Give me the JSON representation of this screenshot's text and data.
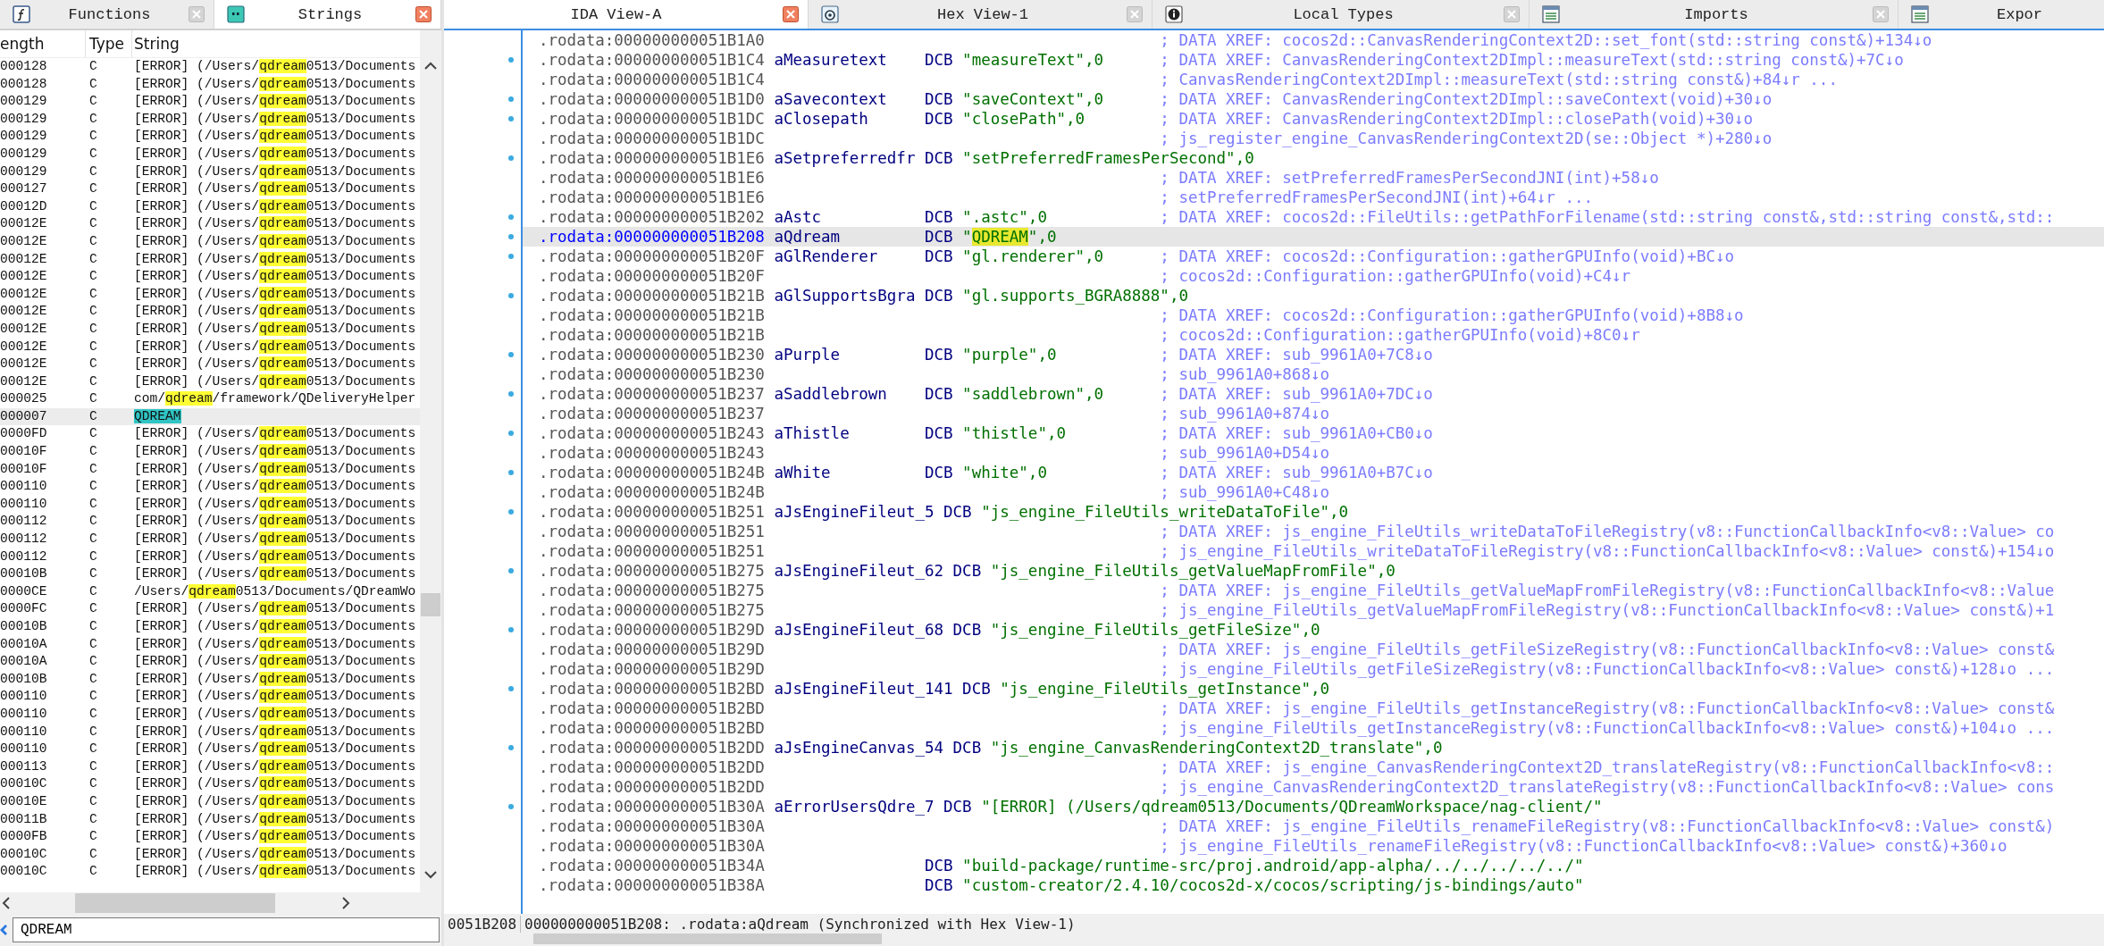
{
  "left_tabs": [
    {
      "label": "Functions",
      "selected": false,
      "kind": "functions"
    },
    {
      "label": "Strings",
      "selected": true,
      "kind": "strings"
    }
  ],
  "strings_table": {
    "columns": [
      "ength",
      "Type",
      "String"
    ],
    "rows": [
      {
        "length": "000128",
        "type": "C",
        "before": "[ERROR] (/Users/",
        "match": "qdream",
        "after": "0513/Documents",
        "selected": false
      },
      {
        "length": "000128",
        "type": "C",
        "before": "[ERROR] (/Users/",
        "match": "qdream",
        "after": "0513/Documents",
        "selected": false
      },
      {
        "length": "000129",
        "type": "C",
        "before": "[ERROR] (/Users/",
        "match": "qdream",
        "after": "0513/Documents",
        "selected": false
      },
      {
        "length": "000129",
        "type": "C",
        "before": "[ERROR] (/Users/",
        "match": "qdream",
        "after": "0513/Documents",
        "selected": false
      },
      {
        "length": "000129",
        "type": "C",
        "before": "[ERROR] (/Users/",
        "match": "qdream",
        "after": "0513/Documents",
        "selected": false
      },
      {
        "length": "000129",
        "type": "C",
        "before": "[ERROR] (/Users/",
        "match": "qdream",
        "after": "0513/Documents",
        "selected": false
      },
      {
        "length": "000129",
        "type": "C",
        "before": "[ERROR] (/Users/",
        "match": "qdream",
        "after": "0513/Documents",
        "selected": false
      },
      {
        "length": "000127",
        "type": "C",
        "before": "[ERROR] (/Users/",
        "match": "qdream",
        "after": "0513/Documents",
        "selected": false
      },
      {
        "length": "00012D",
        "type": "C",
        "before": "[ERROR] (/Users/",
        "match": "qdream",
        "after": "0513/Documents",
        "selected": false
      },
      {
        "length": "00012E",
        "type": "C",
        "before": "[ERROR] (/Users/",
        "match": "qdream",
        "after": "0513/Documents",
        "selected": false
      },
      {
        "length": "00012E",
        "type": "C",
        "before": "[ERROR] (/Users/",
        "match": "qdream",
        "after": "0513/Documents",
        "selected": false
      },
      {
        "length": "00012E",
        "type": "C",
        "before": "[ERROR] (/Users/",
        "match": "qdream",
        "after": "0513/Documents",
        "selected": false
      },
      {
        "length": "00012E",
        "type": "C",
        "before": "[ERROR] (/Users/",
        "match": "qdream",
        "after": "0513/Documents",
        "selected": false
      },
      {
        "length": "00012E",
        "type": "C",
        "before": "[ERROR] (/Users/",
        "match": "qdream",
        "after": "0513/Documents",
        "selected": false
      },
      {
        "length": "00012E",
        "type": "C",
        "before": "[ERROR] (/Users/",
        "match": "qdream",
        "after": "0513/Documents",
        "selected": false
      },
      {
        "length": "00012E",
        "type": "C",
        "before": "[ERROR] (/Users/",
        "match": "qdream",
        "after": "0513/Documents",
        "selected": false
      },
      {
        "length": "00012E",
        "type": "C",
        "before": "[ERROR] (/Users/",
        "match": "qdream",
        "after": "0513/Documents",
        "selected": false
      },
      {
        "length": "00012E",
        "type": "C",
        "before": "[ERROR] (/Users/",
        "match": "qdream",
        "after": "0513/Documents",
        "selected": false
      },
      {
        "length": "00012E",
        "type": "C",
        "before": "[ERROR] (/Users/",
        "match": "qdream",
        "after": "0513/Documents",
        "selected": false
      },
      {
        "length": "000025",
        "type": "C",
        "before": "com/",
        "match": "qdream",
        "after": "/framework/QDeliveryHelper",
        "selected": false
      },
      {
        "length": "000007",
        "type": "C",
        "match": "QDREAM",
        "selected": true
      },
      {
        "length": "0000FD",
        "type": "C",
        "before": "[ERROR] (/Users/",
        "match": "qdream",
        "after": "0513/Documents",
        "selected": false
      },
      {
        "length": "00010F",
        "type": "C",
        "before": "[ERROR] (/Users/",
        "match": "qdream",
        "after": "0513/Documents",
        "selected": false
      },
      {
        "length": "00010F",
        "type": "C",
        "before": "[ERROR] (/Users/",
        "match": "qdream",
        "after": "0513/Documents",
        "selected": false
      },
      {
        "length": "000110",
        "type": "C",
        "before": "[ERROR] (/Users/",
        "match": "qdream",
        "after": "0513/Documents",
        "selected": false
      },
      {
        "length": "000110",
        "type": "C",
        "before": "[ERROR] (/Users/",
        "match": "qdream",
        "after": "0513/Documents",
        "selected": false
      },
      {
        "length": "000112",
        "type": "C",
        "before": "[ERROR] (/Users/",
        "match": "qdream",
        "after": "0513/Documents",
        "selected": false
      },
      {
        "length": "000112",
        "type": "C",
        "before": "[ERROR] (/Users/",
        "match": "qdream",
        "after": "0513/Documents",
        "selected": false
      },
      {
        "length": "000112",
        "type": "C",
        "before": "[ERROR] (/Users/",
        "match": "qdream",
        "after": "0513/Documents",
        "selected": false
      },
      {
        "length": "00010B",
        "type": "C",
        "before": "[ERROR] (/Users/",
        "match": "qdream",
        "after": "0513/Documents",
        "selected": false
      },
      {
        "length": "0000CE",
        "type": "C",
        "before": "/Users/",
        "match": "qdream",
        "after": "0513/Documents/QDreamWo",
        "selected": false
      },
      {
        "length": "0000FC",
        "type": "C",
        "before": "[ERROR] (/Users/",
        "match": "qdream",
        "after": "0513/Documents",
        "selected": false
      },
      {
        "length": "00010B",
        "type": "C",
        "before": "[ERROR] (/Users/",
        "match": "qdream",
        "after": "0513/Documents",
        "selected": false
      },
      {
        "length": "00010A",
        "type": "C",
        "before": "[ERROR] (/Users/",
        "match": "qdream",
        "after": "0513/Documents",
        "selected": false
      },
      {
        "length": "00010A",
        "type": "C",
        "before": "[ERROR] (/Users/",
        "match": "qdream",
        "after": "0513/Documents",
        "selected": false
      },
      {
        "length": "00010B",
        "type": "C",
        "before": "[ERROR] (/Users/",
        "match": "qdream",
        "after": "0513/Documents",
        "selected": false
      },
      {
        "length": "000110",
        "type": "C",
        "before": "[ERROR] (/Users/",
        "match": "qdream",
        "after": "0513/Documents",
        "selected": false
      },
      {
        "length": "000110",
        "type": "C",
        "before": "[ERROR] (/Users/",
        "match": "qdream",
        "after": "0513/Documents",
        "selected": false
      },
      {
        "length": "000110",
        "type": "C",
        "before": "[ERROR] (/Users/",
        "match": "qdream",
        "after": "0513/Documents",
        "selected": false
      },
      {
        "length": "000110",
        "type": "C",
        "before": "[ERROR] (/Users/",
        "match": "qdream",
        "after": "0513/Documents",
        "selected": false
      },
      {
        "length": "000113",
        "type": "C",
        "before": "[ERROR] (/Users/",
        "match": "qdream",
        "after": "0513/Documents",
        "selected": false
      },
      {
        "length": "00010C",
        "type": "C",
        "before": "[ERROR] (/Users/",
        "match": "qdream",
        "after": "0513/Documents",
        "selected": false
      },
      {
        "length": "00010E",
        "type": "C",
        "before": "[ERROR] (/Users/",
        "match": "qdream",
        "after": "0513/Documents",
        "selected": false
      },
      {
        "length": "00011B",
        "type": "C",
        "before": "[ERROR] (/Users/",
        "match": "qdream",
        "after": "0513/Documents",
        "selected": false
      },
      {
        "length": "0000FB",
        "type": "C",
        "before": "[ERROR] (/Users/",
        "match": "qdream",
        "after": "0513/Documents",
        "selected": false
      },
      {
        "length": "00010C",
        "type": "C",
        "before": "[ERROR] (/Users/",
        "match": "qdream",
        "after": "0513/Documents",
        "selected": false
      },
      {
        "length": "00010C",
        "type": "C",
        "before": "[ERROR] (/Users/",
        "match": "qdream",
        "after": "0513/Documents",
        "selected": false
      }
    ]
  },
  "search": {
    "value": "QDREAM"
  },
  "tabs": [
    {
      "label": "IDA View-A",
      "selected": true,
      "kind": "ida"
    },
    {
      "label": "Hex View-1",
      "selected": false,
      "kind": "hex"
    },
    {
      "label": "Local Types",
      "selected": false,
      "kind": "types"
    },
    {
      "label": "Imports",
      "selected": false,
      "kind": "imports"
    },
    {
      "label": "Expor",
      "selected": false,
      "kind": "exports"
    }
  ],
  "listing": [
    {
      "address": ".rodata:000000000051B1A0",
      "marked": false,
      "selected": false,
      "comment": "; DATA XREF: cocos2d::CanvasRenderingContext2D::set_font(std::string const&)+134↓o"
    },
    {
      "address": ".rodata:000000000051B1C4",
      "marked": true,
      "selected": false,
      "label": "aMeasuretext",
      "directive": "DCB",
      "value": "\"measureText\",0",
      "comment": "; DATA XREF: CanvasRenderingContext2DImpl::measureText(std::string const&)+7C↓o"
    },
    {
      "address": ".rodata:000000000051B1C4",
      "marked": false,
      "selected": false,
      "comment": "; CanvasRenderingContext2DImpl::measureText(std::string const&)+84↓r ..."
    },
    {
      "address": ".rodata:000000000051B1D0",
      "marked": true,
      "selected": false,
      "label": "aSavecontext",
      "directive": "DCB",
      "value": "\"saveContext\",0",
      "comment": "; DATA XREF: CanvasRenderingContext2DImpl::saveContext(void)+30↓o"
    },
    {
      "address": ".rodata:000000000051B1DC",
      "marked": true,
      "selected": false,
      "label": "aClosepath",
      "directive": "DCB",
      "value": "\"closePath\",0",
      "comment": "; DATA XREF: CanvasRenderingContext2DImpl::closePath(void)+30↓o"
    },
    {
      "address": ".rodata:000000000051B1DC",
      "marked": false,
      "selected": false,
      "comment": "; js_register_engine_CanvasRenderingContext2D(se::Object *)+280↓o"
    },
    {
      "address": ".rodata:000000000051B1E6",
      "marked": true,
      "selected": false,
      "label": "aSetpreferredfr",
      "directive": "DCB",
      "value": "\"setPreferredFramesPerSecond\",0"
    },
    {
      "address": ".rodata:000000000051B1E6",
      "marked": false,
      "selected": false,
      "comment": "; DATA XREF: setPreferredFramesPerSecondJNI(int)+58↓o"
    },
    {
      "address": ".rodata:000000000051B1E6",
      "marked": false,
      "selected": false,
      "comment": "; setPreferredFramesPerSecondJNI(int)+64↓r ..."
    },
    {
      "address": ".rodata:000000000051B202",
      "marked": true,
      "selected": false,
      "label": "aAstc",
      "directive": "DCB",
      "value": "\".astc\",0",
      "comment": "; DATA XREF: cocos2d::FileUtils::getPathForFilename(std::string const&,std::string const&,std::"
    },
    {
      "address": ".rodata:000000000051B208",
      "marked": true,
      "selected": true,
      "label": "aQdream",
      "directive": "DCB",
      "value_before": "\"",
      "match": "QDREAM",
      "value_after": "\",0"
    },
    {
      "address": ".rodata:000000000051B20F",
      "marked": true,
      "selected": false,
      "label": "aGlRenderer",
      "directive": "DCB",
      "value": "\"gl.renderer\",0",
      "comment": "; DATA XREF: cocos2d::Configuration::gatherGPUInfo(void)+BC↓o"
    },
    {
      "address": ".rodata:000000000051B20F",
      "marked": false,
      "selected": false,
      "comment": "; cocos2d::Configuration::gatherGPUInfo(void)+C4↓r"
    },
    {
      "address": ".rodata:000000000051B21B",
      "marked": true,
      "selected": false,
      "label": "aGlSupportsBgra",
      "directive": "DCB",
      "value": "\"gl.supports_BGRA8888\",0"
    },
    {
      "address": ".rodata:000000000051B21B",
      "marked": false,
      "selected": false,
      "comment": "; DATA XREF: cocos2d::Configuration::gatherGPUInfo(void)+8B8↓o"
    },
    {
      "address": ".rodata:000000000051B21B",
      "marked": false,
      "selected": false,
      "comment": "; cocos2d::Configuration::gatherGPUInfo(void)+8C0↓r"
    },
    {
      "address": ".rodata:000000000051B230",
      "marked": true,
      "selected": false,
      "label": "aPurple",
      "directive": "DCB",
      "value": "\"purple\",0",
      "comment": "; DATA XREF: sub_9961A0+7C8↓o"
    },
    {
      "address": ".rodata:000000000051B230",
      "marked": false,
      "selected": false,
      "comment": "; sub_9961A0+868↓o"
    },
    {
      "address": ".rodata:000000000051B237",
      "marked": true,
      "selected": false,
      "label": "aSaddlebrown",
      "directive": "DCB",
      "value": "\"saddlebrown\",0",
      "comment": "; DATA XREF: sub_9961A0+7DC↓o"
    },
    {
      "address": ".rodata:000000000051B237",
      "marked": false,
      "selected": false,
      "comment": "; sub_9961A0+874↓o"
    },
    {
      "address": ".rodata:000000000051B243",
      "marked": true,
      "selected": false,
      "label": "aThistle",
      "directive": "DCB",
      "value": "\"thistle\",0",
      "comment": "; DATA XREF: sub_9961A0+CB0↓o"
    },
    {
      "address": ".rodata:000000000051B243",
      "marked": false,
      "selected": false,
      "comment": "; sub_9961A0+D54↓o"
    },
    {
      "address": ".rodata:000000000051B24B",
      "marked": true,
      "selected": false,
      "label": "aWhite",
      "directive": "DCB",
      "value": "\"white\",0",
      "comment": "; DATA XREF: sub_9961A0+B7C↓o"
    },
    {
      "address": ".rodata:000000000051B24B",
      "marked": false,
      "selected": false,
      "comment": "; sub_9961A0+C48↓o"
    },
    {
      "address": ".rodata:000000000051B251",
      "marked": true,
      "selected": false,
      "label": "aJsEngineFileut_5",
      "directive": "DCB",
      "value": "\"js_engine_FileUtils_writeDataToFile\",0"
    },
    {
      "address": ".rodata:000000000051B251",
      "marked": false,
      "selected": false,
      "comment": "; DATA XREF: js_engine_FileUtils_writeDataToFileRegistry(v8::FunctionCallbackInfo<v8::Value> co"
    },
    {
      "address": ".rodata:000000000051B251",
      "marked": false,
      "selected": false,
      "comment": "; js_engine_FileUtils_writeDataToFileRegistry(v8::FunctionCallbackInfo<v8::Value> const&)+154↓o"
    },
    {
      "address": ".rodata:000000000051B275",
      "marked": true,
      "selected": false,
      "label": "aJsEngineFileut_62",
      "directive": "DCB",
      "value": "\"js_engine_FileUtils_getValueMapFromFile\",0"
    },
    {
      "address": ".rodata:000000000051B275",
      "marked": false,
      "selected": false,
      "comment": "; DATA XREF: js_engine_FileUtils_getValueMapFromFileRegistry(v8::FunctionCallbackInfo<v8::Value"
    },
    {
      "address": ".rodata:000000000051B275",
      "marked": false,
      "selected": false,
      "comment": "; js_engine_FileUtils_getValueMapFromFileRegistry(v8::FunctionCallbackInfo<v8::Value> const&)+1"
    },
    {
      "address": ".rodata:000000000051B29D",
      "marked": true,
      "selected": false,
      "label": "aJsEngineFileut_68",
      "directive": "DCB",
      "value": "\"js_engine_FileUtils_getFileSize\",0"
    },
    {
      "address": ".rodata:000000000051B29D",
      "marked": false,
      "selected": false,
      "comment": "; DATA XREF: js_engine_FileUtils_getFileSizeRegistry(v8::FunctionCallbackInfo<v8::Value> const&"
    },
    {
      "address": ".rodata:000000000051B29D",
      "marked": false,
      "selected": false,
      "comment": "; js_engine_FileUtils_getFileSizeRegistry(v8::FunctionCallbackInfo<v8::Value> const&)+128↓o ..."
    },
    {
      "address": ".rodata:000000000051B2BD",
      "marked": true,
      "selected": false,
      "label": "aJsEngineFileut_141",
      "directive": "DCB",
      "value": "\"js_engine_FileUtils_getInstance\",0"
    },
    {
      "address": ".rodata:000000000051B2BD",
      "marked": false,
      "selected": false,
      "comment": "; DATA XREF: js_engine_FileUtils_getInstanceRegistry(v8::FunctionCallbackInfo<v8::Value> const&"
    },
    {
      "address": ".rodata:000000000051B2BD",
      "marked": false,
      "selected": false,
      "comment": "; js_engine_FileUtils_getInstanceRegistry(v8::FunctionCallbackInfo<v8::Value> const&)+104↓o ..."
    },
    {
      "address": ".rodata:000000000051B2DD",
      "marked": true,
      "selected": false,
      "label": "aJsEngineCanvas_54",
      "directive": "DCB",
      "value": "\"js_engine_CanvasRenderingContext2D_translate\",0"
    },
    {
      "address": ".rodata:000000000051B2DD",
      "marked": false,
      "selected": false,
      "comment": "; DATA XREF: js_engine_CanvasRenderingContext2D_translateRegistry(v8::FunctionCallbackInfo<v8::"
    },
    {
      "address": ".rodata:000000000051B2DD",
      "marked": false,
      "selected": false,
      "comment": "; js_engine_CanvasRenderingContext2D_translateRegistry(v8::FunctionCallbackInfo<v8::Value> cons"
    },
    {
      "address": ".rodata:000000000051B30A",
      "marked": true,
      "selected": false,
      "label": "aErrorUsersQdre_7",
      "directive": "DCB",
      "value": "\"[ERROR] (/Users/qdream0513/Documents/QDreamWorkspace/nag-client/\""
    },
    {
      "address": ".rodata:000000000051B30A",
      "marked": false,
      "selected": false,
      "comment": "; DATA XREF: js_engine_FileUtils_renameFileRegistry(v8::FunctionCallbackInfo<v8::Value> const&)"
    },
    {
      "address": ".rodata:000000000051B30A",
      "marked": false,
      "selected": false,
      "comment": "; js_engine_FileUtils_renameFileRegistry(v8::FunctionCallbackInfo<v8::Value> const&)+360↓o"
    },
    {
      "address": ".rodata:000000000051B34A",
      "marked": false,
      "selected": false,
      "directive": "DCB",
      "value": "\"build-package/runtime-src/proj.android/app-alpha/../../../../../\""
    },
    {
      "address": ".rodata:000000000051B38A",
      "marked": false,
      "selected": false,
      "directive": "DCB",
      "value": "\"custom-creator/2.4.10/cocos2d-x/cocos/scripting/js-bindings/auto\""
    }
  ],
  "status_bar": {
    "offset": "0051B208",
    "location": "000000000051B208: .rodata:aQdream (Synchronized with Hex View-1)"
  }
}
